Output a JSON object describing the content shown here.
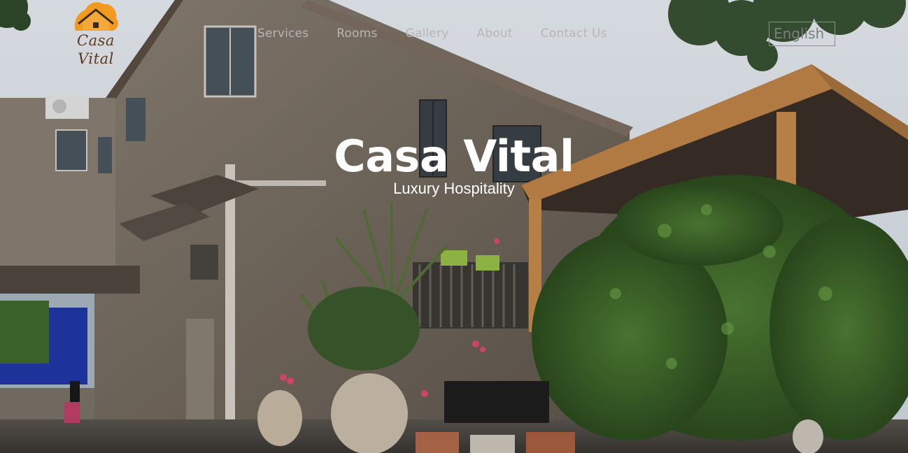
{
  "brand": {
    "logo_line1": "Casa",
    "logo_line2": "Vital",
    "logo_color": "#f29a1f",
    "text_color": "#5a3a22"
  },
  "nav": {
    "items": [
      {
        "label": "Services"
      },
      {
        "label": "Rooms"
      },
      {
        "label": "Gallery"
      },
      {
        "label": "About"
      },
      {
        "label": "Contact Us"
      }
    ],
    "language": "English"
  },
  "hero": {
    "title": "Casa Vital",
    "subtitle": "Luxury Hospitality"
  },
  "colors": {
    "sky": "#dfe6ee",
    "wall": "#7a6f64",
    "foliage": "#3f6b2e",
    "wood": "#b9783f",
    "text": "#ffffff"
  }
}
